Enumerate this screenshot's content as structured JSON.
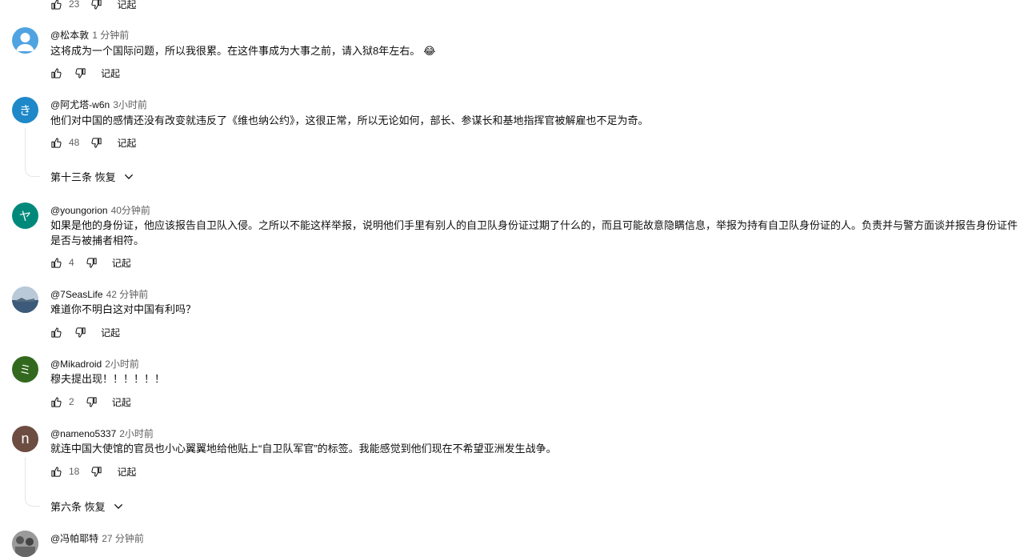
{
  "top_row": {
    "likes": "23",
    "reply_label": "记起"
  },
  "comments": [
    {
      "handle": "@松本敦",
      "time": "1 分钟前",
      "text": "这将成为一个国际问题，所以我很累。在这件事成为大事之前，请入狱8年左右。",
      "emoji": "😂",
      "likes": "",
      "reply_label": "记起",
      "avatar": {
        "type": "default",
        "color": "#4fa3e0"
      }
    },
    {
      "handle": "@阿尤塔-w6n",
      "time": "3小时前",
      "text": "他们对中国的感情还没有改变就违反了《维也纳公约》，这很正常，所以无论如何，部长、参谋长和基地指挥官被解雇也不足为奇。",
      "likes": "48",
      "reply_label": "记起",
      "avatar": {
        "type": "letter",
        "letter": "き",
        "color": "#1e88c8"
      },
      "replies_label": "第十三条 恢复"
    },
    {
      "handle": "@youngorion",
      "time": "40分钟前",
      "text": "如果是他的身份证，他应该报告自卫队入侵。之所以不能这样举报，说明他们手里有别人的自卫队身份证过期了什么的，而且可能故意隐瞒信息，举报为持有自卫队身份证的人。负责并与警方面谈并报告身份证件",
      "text2": "是否与被捕者相符。",
      "likes": "4",
      "reply_label": "记起",
      "avatar": {
        "type": "letter",
        "letter": "ヤ",
        "color": "#00897b"
      }
    },
    {
      "handle": "@7SeasLife",
      "time": "42 分钟前",
      "text": "难道你不明白这对中国有利吗？",
      "likes": "",
      "reply_label": "记起",
      "avatar": {
        "type": "photo"
      }
    },
    {
      "handle": "@Mikadroid",
      "time": "2小时前",
      "text": "穆夫提出现！！！！！！",
      "likes": "2",
      "reply_label": "记起",
      "avatar": {
        "type": "letter",
        "letter": "ミ",
        "color": "#33691e"
      }
    },
    {
      "handle": "@nameno5337",
      "time": "2小时前",
      "text": "就连中国大使馆的官员也小心翼翼地给他贴上“自卫队军官”的标签。我能感觉到他们现在不希望亚洲发生战争。",
      "likes": "18",
      "reply_label": "记起",
      "avatar": {
        "type": "letter",
        "letter": "n",
        "color": "#6d4c41"
      },
      "replies_label": "第六条 恢复"
    },
    {
      "handle": "@冯帕耶特",
      "time": "27 分钟前",
      "avatar": {
        "type": "photo2"
      }
    }
  ]
}
